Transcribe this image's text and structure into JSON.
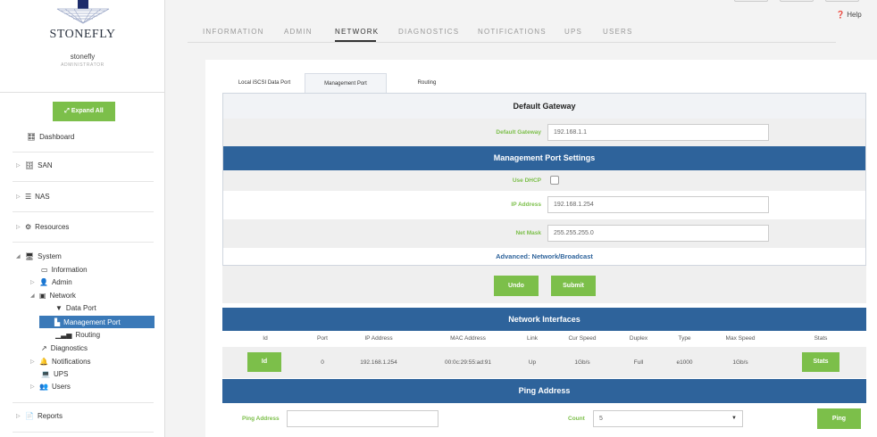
{
  "brand": {
    "name": "STONEFLY"
  },
  "user": {
    "name": "stonefly",
    "role": "ADMINISTRATOR"
  },
  "sidebar": {
    "expand_label": "Expand All",
    "items": [
      {
        "label": "Dashboard"
      },
      {
        "label": "SAN"
      },
      {
        "label": "NAS"
      },
      {
        "label": "Resources"
      },
      {
        "label": "System"
      },
      {
        "label": "Information"
      },
      {
        "label": "Admin"
      },
      {
        "label": "Network"
      },
      {
        "label": "Data Port"
      },
      {
        "label": "Management Port"
      },
      {
        "label": "Routing"
      },
      {
        "label": "Diagnostics"
      },
      {
        "label": "Notifications"
      },
      {
        "label": "UPS"
      },
      {
        "label": "Users"
      },
      {
        "label": "Reports"
      }
    ]
  },
  "header": {
    "help": "Help",
    "tabs": [
      "INFORMATION",
      "ADMIN",
      "NETWORK",
      "DIAGNOSTICS",
      "NOTIFICATIONS",
      "UPS",
      "USERS"
    ],
    "active_tab": "NETWORK"
  },
  "subtabs": [
    "Local iSCSI Data Port",
    "Management Port",
    "Routing"
  ],
  "gateway": {
    "title": "Default Gateway",
    "label": "Default Gateway",
    "value": "192.168.1.1"
  },
  "mgmt": {
    "title": "Management Port Settings",
    "dhcp_label": "Use DHCP",
    "ip_label": "IP Address",
    "ip_value": "192.168.1.254",
    "mask_label": "Net Mask",
    "mask_value": "255.255.255.0",
    "advanced": "Advanced: Network/Broadcast",
    "undo": "Undo",
    "submit": "Submit"
  },
  "interfaces": {
    "title": "Network Interfaces",
    "headers": [
      "Id",
      "Port",
      "IP Address",
      "MAC Address",
      "Link",
      "Cur Speed",
      "Duplex",
      "Type",
      "Max Speed",
      "Stats"
    ],
    "row": {
      "id": "Id",
      "port": "0",
      "ip": "192.168.1.254",
      "mac": "00:0c:29:55:ad:91",
      "link": "Up",
      "cur_speed": "1Gb/s",
      "duplex": "Full",
      "type": "e1000",
      "max_speed": "1Gb/s",
      "stats": "Stats"
    }
  },
  "ping": {
    "title": "Ping Address",
    "address_label": "Ping Address",
    "address_value": "",
    "count_label": "Count",
    "count_value": "5",
    "button": "Ping"
  },
  "colors": {
    "accent_green": "#7cbf4a",
    "header_blue": "#2e639b",
    "active_blue": "#3a79b8"
  }
}
